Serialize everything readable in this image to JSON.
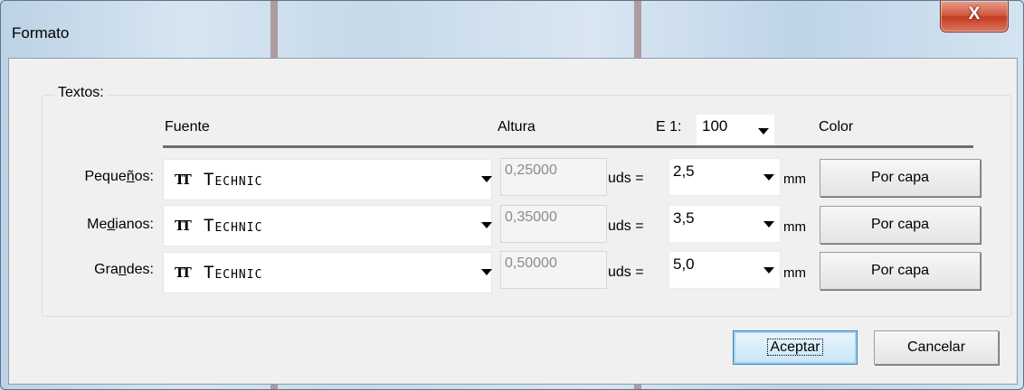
{
  "window": {
    "title": "Formato",
    "close_label": "X"
  },
  "group": {
    "label": "Textos:"
  },
  "headers": {
    "font": "Fuente",
    "height": "Altura",
    "scale_label": "E 1:",
    "scale_value": "100",
    "color": "Color"
  },
  "rows": [
    {
      "label_pre": "Peque",
      "label_key": "ñ",
      "label_post": "os:",
      "font": "Technic",
      "height": "0,25000",
      "units": "uds =",
      "size": "2,5",
      "mm": "mm",
      "color": "Por capa"
    },
    {
      "label_pre": "Me",
      "label_key": "d",
      "label_post": "ianos:",
      "font": "Technic",
      "height": "0,35000",
      "units": "uds =",
      "size": "3,5",
      "mm": "mm",
      "color": "Por capa"
    },
    {
      "label_pre": "Gra",
      "label_key": "n",
      "label_post": "des:",
      "font": "Technic",
      "height": "0,50000",
      "units": "uds =",
      "size": "5,0",
      "mm": "mm",
      "color": "Por capa"
    }
  ],
  "buttons": {
    "ok": "Aceptar",
    "cancel": "Cancelar"
  },
  "icons": {
    "font_type": "truetype-font-icon",
    "dropdown": "chevron-down-icon"
  },
  "colors": {
    "dialog_bg": "#f0f0f0",
    "close_button": "#c33b22",
    "default_button_border": "#3c7fb1"
  }
}
